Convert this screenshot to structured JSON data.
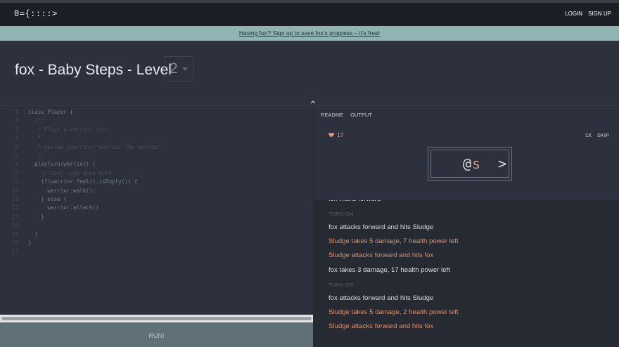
{
  "topbar": {
    "logo": "0={::::>",
    "login": "LOGIN",
    "signup": "SIGN UP"
  },
  "banner": {
    "text": "Having fun? Sign up to save fox's progress – it's free!"
  },
  "header": {
    "title": "fox - Baby Steps - Level",
    "level": "2"
  },
  "editor": {
    "lines": [
      {
        "num": "1",
        "code": "class Player {",
        "comment": false
      },
      {
        "num": "2",
        "code": "  /**",
        "comment": true
      },
      {
        "num": "3",
        "code": "   * Plays a warrior turn.",
        "comment": true
      },
      {
        "num": "4",
        "code": "   *",
        "comment": true
      },
      {
        "num": "5",
        "code": "   * @param {Warrior} warrior The warrior.",
        "comment": true
      },
      {
        "num": "6",
        "code": "   */",
        "comment": true
      },
      {
        "num": "7",
        "code": "  playTurn(warrior) {",
        "comment": false
      },
      {
        "num": "8",
        "code": "    // Cool code goes here",
        "comment": true
      },
      {
        "num": "9",
        "code": "    if(warrior.feel().isEmpty()) {",
        "comment": false
      },
      {
        "num": "10",
        "code": "      warrior.walk();",
        "comment": false
      },
      {
        "num": "11",
        "code": "    } else {",
        "comment": false
      },
      {
        "num": "12",
        "code": "      warrior.attack()",
        "comment": false
      },
      {
        "num": "13",
        "code": "    }",
        "comment": false
      },
      {
        "num": "14",
        "code": "",
        "comment": false
      },
      {
        "num": "15",
        "code": "  }",
        "comment": false
      },
      {
        "num": "16",
        "code": "}",
        "comment": false
      },
      {
        "num": "17",
        "code": "",
        "comment": false
      }
    ],
    "run_label": "RUN!"
  },
  "panel": {
    "tabs": [
      "README",
      "OUTPUT"
    ],
    "health": "17",
    "speed_label": "1X",
    "skip_label": "SKIP",
    "board": {
      "warrior": "@",
      "sludge": "s",
      "stairs": ">"
    },
    "log": [
      {
        "text": "fox walks forward",
        "style": "white"
      },
      {
        "text": "TURN 004",
        "style": "turn"
      },
      {
        "text": "fox attacks forward and hits Sludge",
        "style": "white"
      },
      {
        "text": "Sludge takes 5 damage, 7 health power left",
        "style": "orange"
      },
      {
        "text": "Sludge attacks forward and hits fox",
        "style": "orange"
      },
      {
        "text": "fox takes 3 damage, 17 health power left",
        "style": "white"
      },
      {
        "text": "TURN 005",
        "style": "turn"
      },
      {
        "text": "fox attacks forward and hits Sludge",
        "style": "white"
      },
      {
        "text": "Sludge takes 5 damage, 2 health power left",
        "style": "orange"
      },
      {
        "text": "Sludge attacks forward and hits fox",
        "style": "orange"
      }
    ]
  },
  "colors": {
    "accent": "#8fb4b1",
    "damage": "#d9936f",
    "background": "#2c313d"
  }
}
